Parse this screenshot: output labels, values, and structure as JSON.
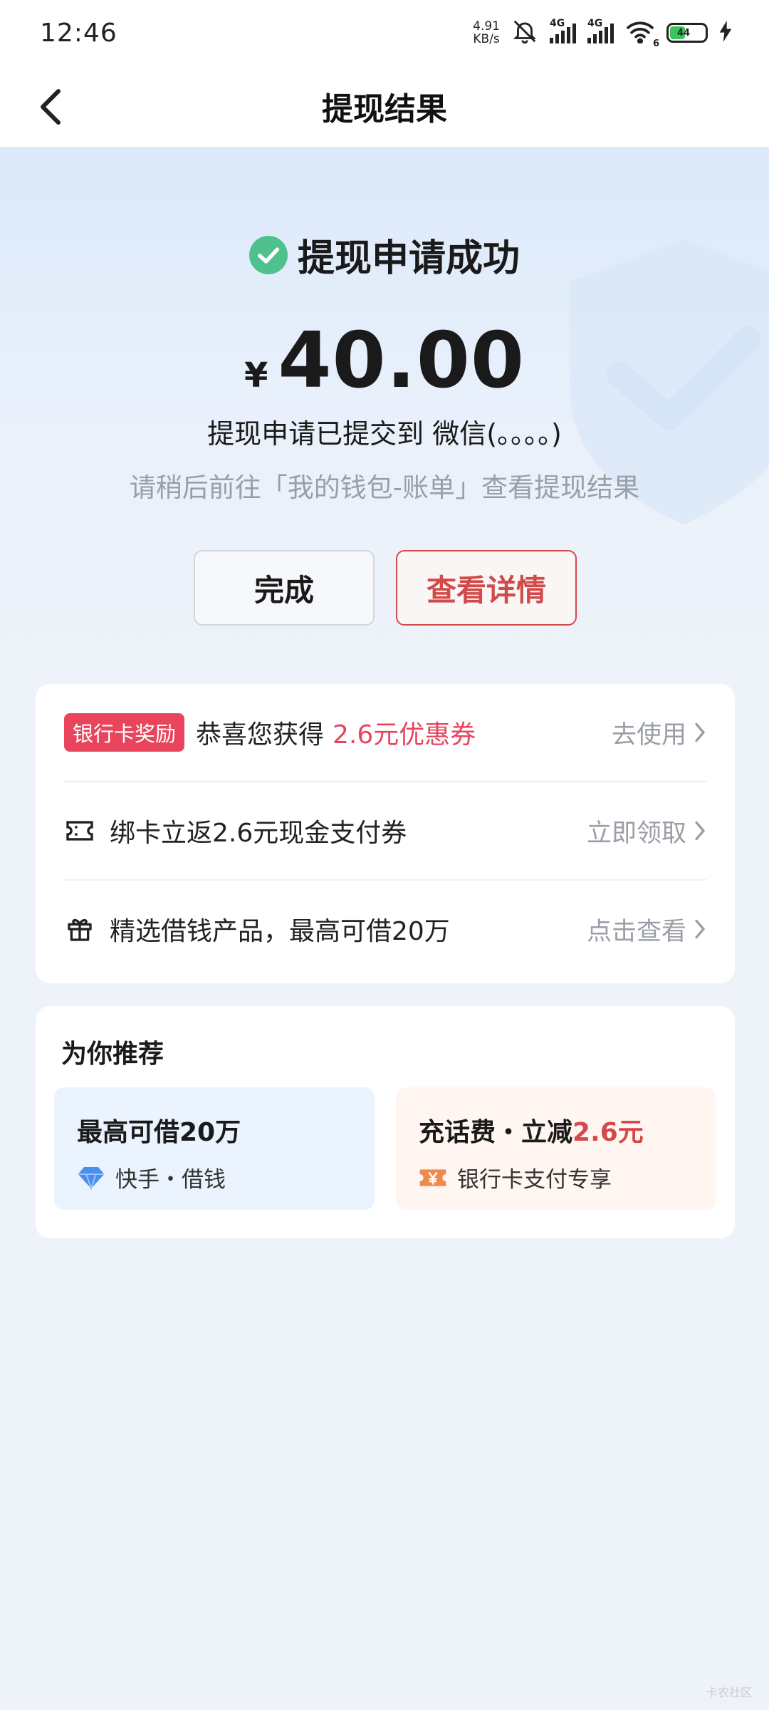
{
  "status_bar": {
    "time": "12:46",
    "net_speed_value": "4.91",
    "net_speed_unit": "KB/s",
    "signal1_label": "4G",
    "signal2_label": "4G",
    "wifi_label": "6",
    "battery": "44",
    "battery_level": 0.44
  },
  "nav": {
    "title": "提现结果"
  },
  "result": {
    "success_text": "提现申请成功",
    "currency": "¥",
    "amount": "40.00",
    "submitted_text": "提现申请已提交到 微信(。。。。)",
    "hint_text": "请稍后前往「我的钱包-账单」查看提现结果"
  },
  "actions": {
    "done_label": "完成",
    "detail_label": "查看详情"
  },
  "rewards": {
    "items": [
      {
        "badge": "银行卡奖励",
        "text": "恭喜您获得",
        "highlight": "2.6元优惠券",
        "action": "去使用",
        "icon": "coupon-badge"
      },
      {
        "text": "绑卡立返2.6元现金支付券",
        "action": "立即领取",
        "icon": "ticket-icon"
      },
      {
        "text": "精选借钱产品，最高可借20万",
        "action": "点击查看",
        "icon": "gift-icon"
      }
    ]
  },
  "recommend": {
    "title": "为你推荐",
    "tiles": [
      {
        "title": "最高可借20万",
        "sub": "快手・借钱",
        "icon": "diamond-icon"
      },
      {
        "title_prefix": "充话费・立减",
        "title_highlight": "2.6元",
        "sub": "银行卡支付专享",
        "icon": "yuan-ticket-icon"
      }
    ]
  },
  "colors": {
    "accent_red": "#d24a4a",
    "badge_pink": "#e8455d",
    "success_green": "#4fc18e"
  },
  "watermark": "卡农社区"
}
